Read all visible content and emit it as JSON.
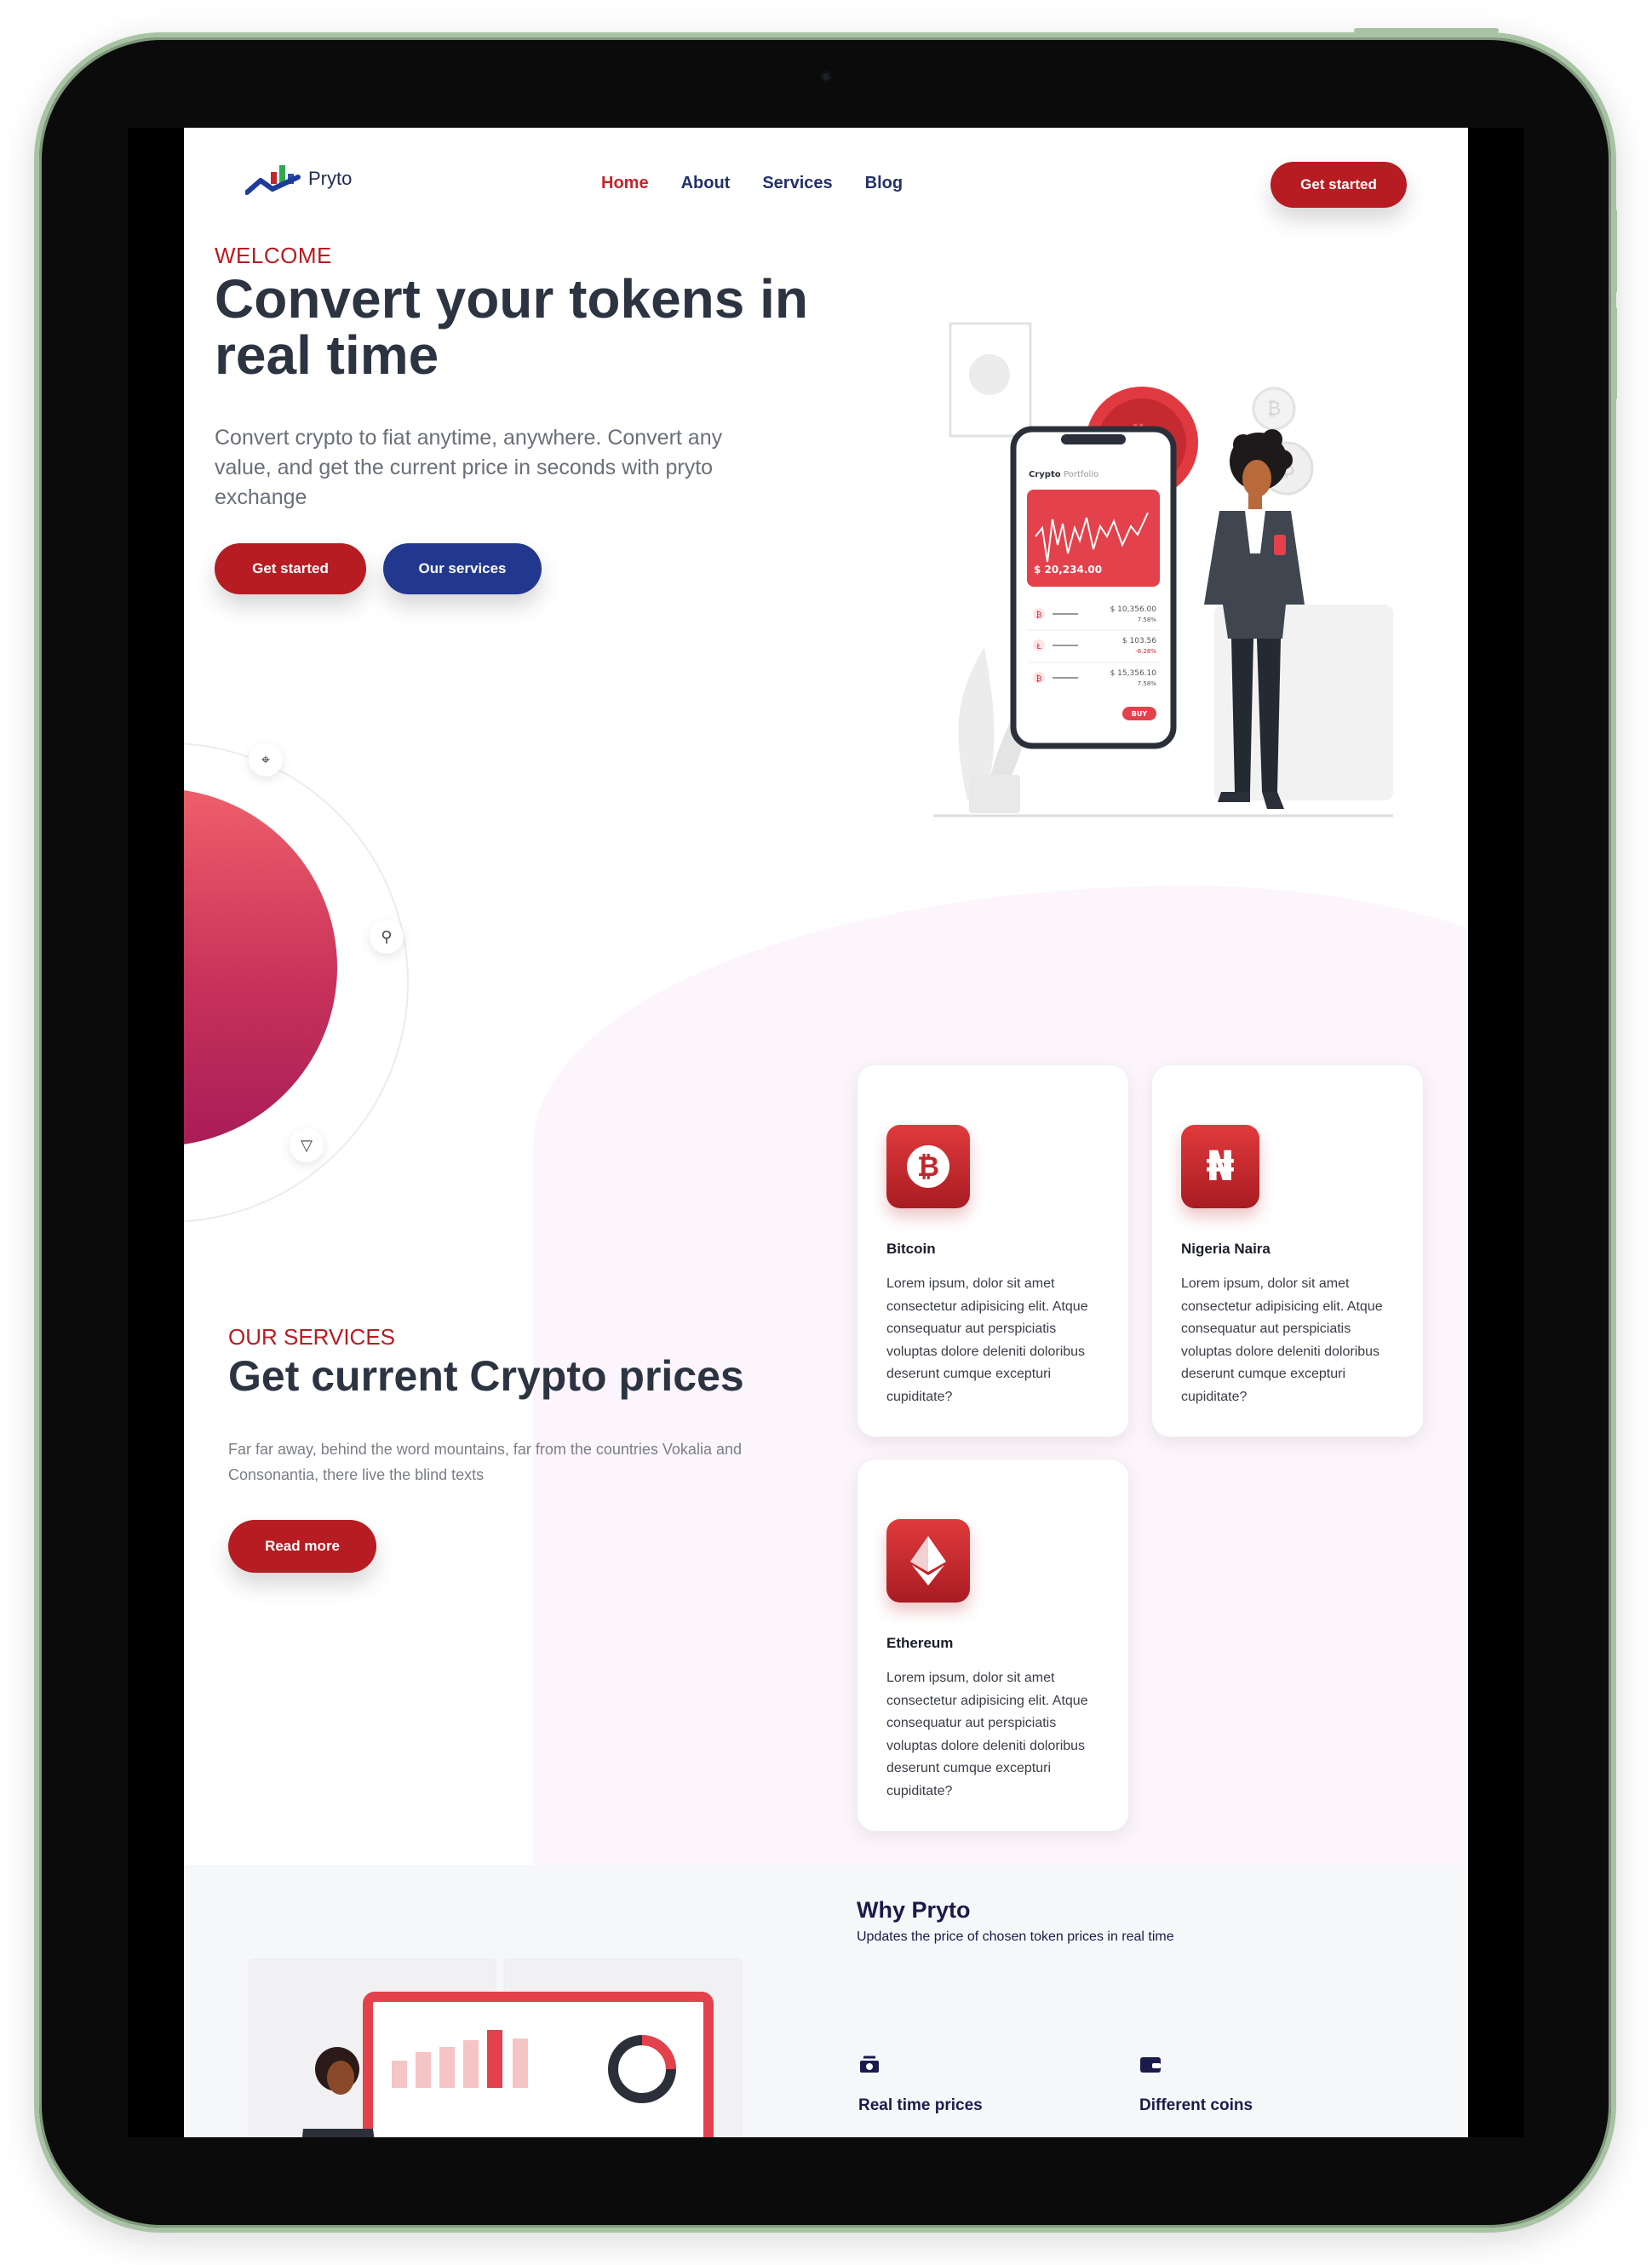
{
  "brand": {
    "name": "Pryto"
  },
  "nav": {
    "links": [
      "Home",
      "About",
      "Services",
      "Blog"
    ],
    "active": "Home",
    "cta": "Get started"
  },
  "hero": {
    "kicker": "WELCOME",
    "title": "Convert your tokens in real time",
    "subtitle": "Convert crypto to fiat anytime, anywhere. Convert any value, and get the current price in seconds with pryto exchange",
    "primary_cta": "Get started",
    "secondary_cta": "Our services",
    "phone": {
      "app_title": "Crypto",
      "app_title_suffix": "Portfolio",
      "balance": "$ 20,234.00",
      "rows": [
        {
          "value": "$ 10,356.00",
          "change": "7.58%"
        },
        {
          "value": "$ 103.56",
          "change": "-6.28%"
        },
        {
          "value": "$ 15,356.10",
          "change": "7.58%"
        }
      ],
      "buy_label": "BUY"
    }
  },
  "services": {
    "kicker": "OUR SERVICES",
    "title": "Get current Crypto prices",
    "subtitle": "Far far away, behind the word mountains, far from the countries Vokalia and Consonantia, there live the blind texts",
    "cta": "Read more",
    "cards": [
      {
        "title": "Bitcoin",
        "icon": "bitcoin-icon",
        "text": "Lorem ipsum, dolor sit amet consectetur adipisicing elit. Atque consequatur aut perspiciatis voluptas dolore deleniti doloribus deserunt cumque excepturi cupiditate?"
      },
      {
        "title": "Nigeria Naira",
        "icon": "naira-icon",
        "text": "Lorem ipsum, dolor sit amet consectetur adipisicing elit. Atque consequatur aut perspiciatis voluptas dolore deleniti doloribus deserunt cumque excepturi cupiditate?"
      },
      {
        "title": "Ethereum",
        "icon": "ethereum-icon",
        "text": "Lorem ipsum, dolor sit amet consectetur adipisicing elit. Atque consequatur aut perspiciatis voluptas dolore deleniti doloribus deserunt cumque excepturi cupiditate?"
      }
    ]
  },
  "why": {
    "title": "Why Pryto",
    "subtitle": "Updates the price of chosen token prices in real time",
    "features": [
      {
        "label": "Real time prices",
        "icon": "money-icon"
      },
      {
        "label": "Different coins",
        "icon": "wallet-icon"
      }
    ]
  },
  "colors": {
    "accent_red": "#b71c22",
    "accent_blue": "#22388e",
    "heading": "#2c3442",
    "device_frame": "#a8c3a4"
  }
}
